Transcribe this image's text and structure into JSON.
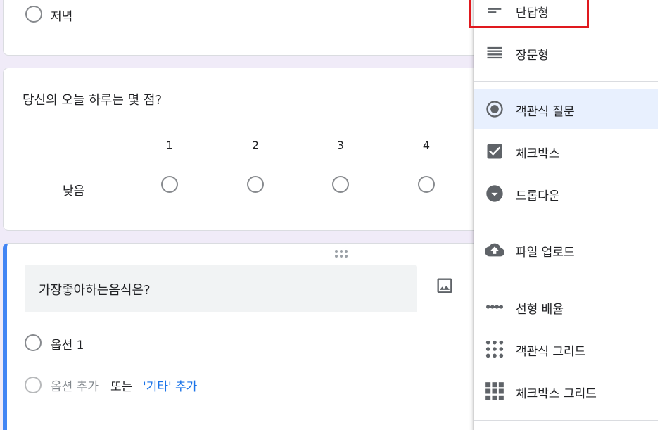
{
  "card1": {
    "option_label": "저녁"
  },
  "card2": {
    "question": "당신의 오늘 하루는 몇 점?",
    "scale_numbers": [
      "1",
      "2",
      "3",
      "4"
    ],
    "low_label": "낮음"
  },
  "card3": {
    "title": "가장좋아하는음식은?",
    "option1": "옵션 1",
    "add_option": "옵션 추가",
    "or_text": "또는",
    "add_other": "'기타' 추가"
  },
  "menu": {
    "items": [
      {
        "label": "단답형",
        "icon": "short-answer-icon"
      },
      {
        "label": "장문형",
        "icon": "paragraph-icon"
      },
      {
        "label": "객관식 질문",
        "icon": "radio-button-icon"
      },
      {
        "label": "체크박스",
        "icon": "checkbox-icon"
      },
      {
        "label": "드롭다운",
        "icon": "dropdown-icon"
      },
      {
        "label": "파일 업로드",
        "icon": "cloud-upload-icon"
      },
      {
        "label": "선형 배율",
        "icon": "linear-scale-icon"
      },
      {
        "label": "객관식 그리드",
        "icon": "grid-dots-icon"
      },
      {
        "label": "체크박스 그리드",
        "icon": "grid-squares-icon"
      }
    ],
    "selected_index": 2
  },
  "colors": {
    "accent": "#4285f4",
    "selected_bg": "#e8f0fe",
    "highlight_box": "#e0191e",
    "link": "#1a73e8"
  }
}
